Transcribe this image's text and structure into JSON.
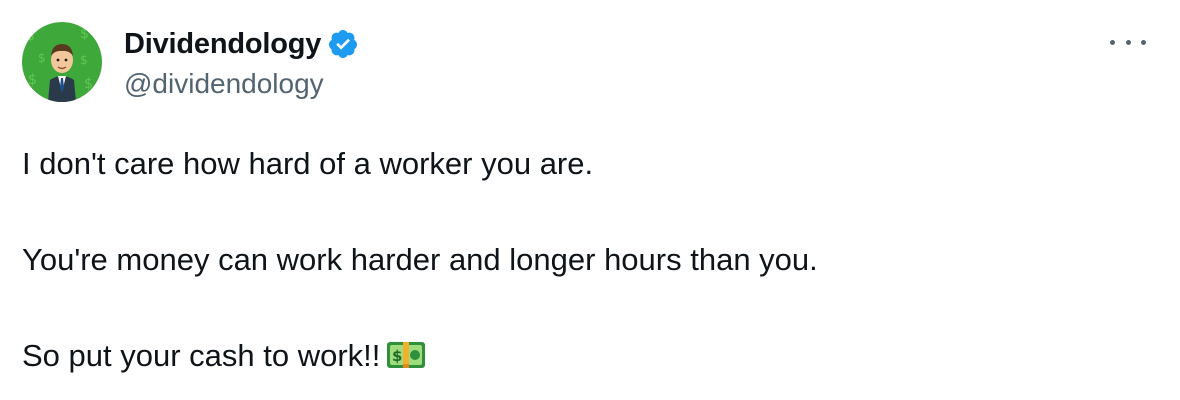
{
  "author": {
    "display_name": "Dividendology",
    "handle": "@dividendology",
    "verified": true,
    "verified_badge_color": "#1d9bf0",
    "avatar_icon": "businessman-on-money-background-icon"
  },
  "header": {
    "more_icon": "more-horizontal-icon"
  },
  "tweet": {
    "lines": [
      "I don't care how hard of a worker you are.",
      "You're money can work harder and longer hours than you.",
      "So put your cash to work!!"
    ],
    "trailing_emoji": "dollar-banknote-icon"
  },
  "colors": {
    "text_primary": "#0f1419",
    "text_secondary": "#536471",
    "accent": "#1d9bf0"
  }
}
